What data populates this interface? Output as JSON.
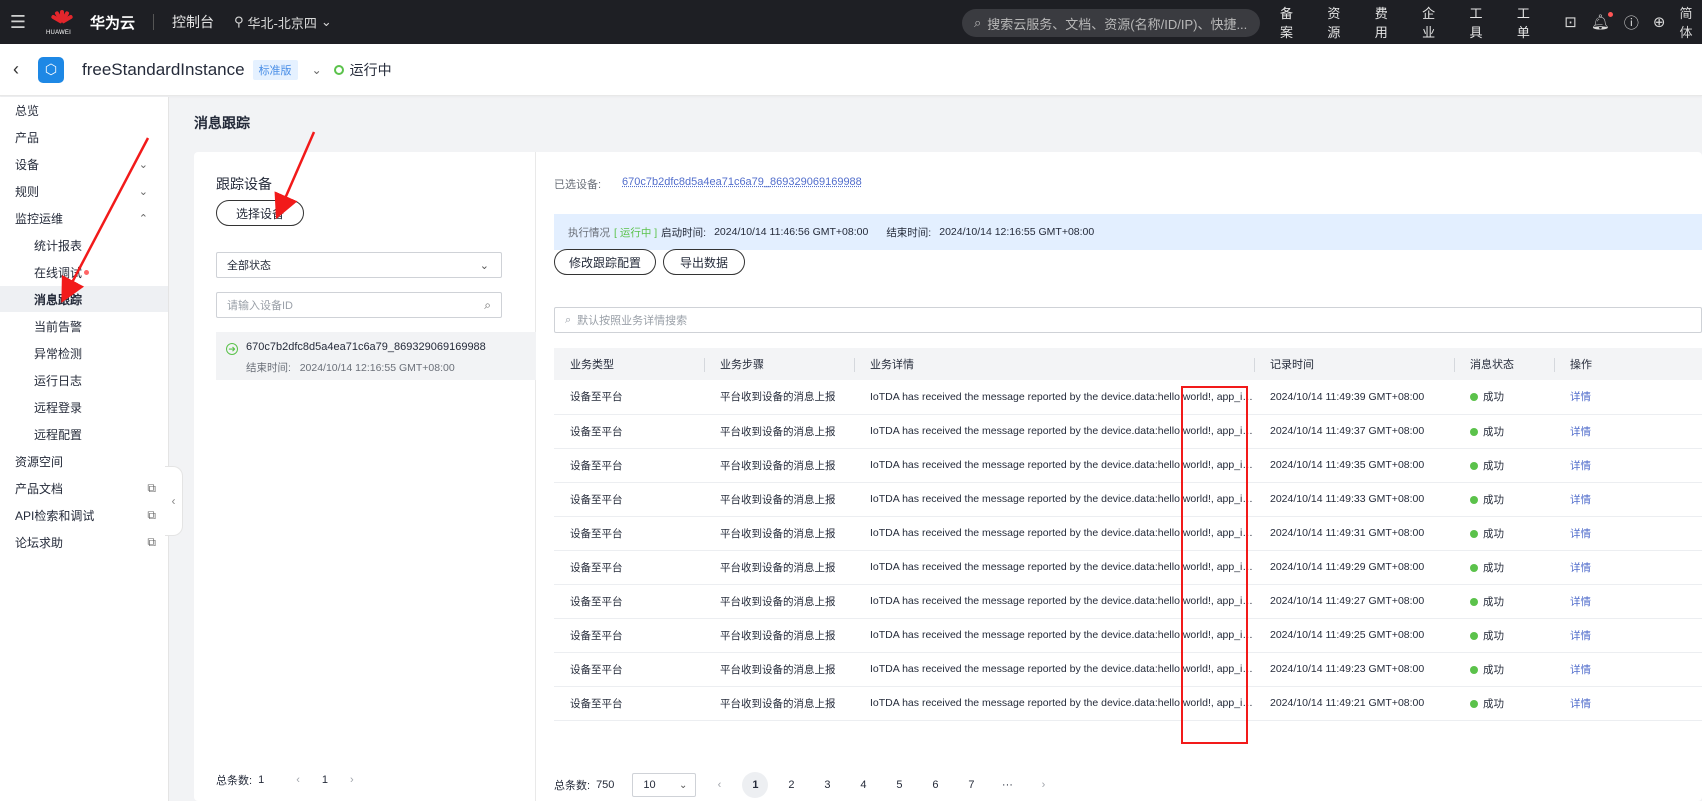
{
  "topbar": {
    "brand_logo_text": "HUAWEI",
    "brand_name": "华为云",
    "console": "控制台",
    "region": "华北-北京四",
    "search_placeholder": "搜索云服务、文档、资源(名称/ID/IP)、快捷...",
    "links": [
      "备案",
      "资源",
      "费用",
      "企业",
      "工具",
      "工单"
    ],
    "language": "简体"
  },
  "instance": {
    "name": "freeStandardInstance",
    "edition": "标准版",
    "status": "运行中"
  },
  "sidebar": {
    "items": [
      {
        "label": "总览"
      },
      {
        "label": "产品"
      },
      {
        "label": "设备"
      },
      {
        "label": "规则"
      },
      {
        "label": "监控运维"
      },
      {
        "label": "统计报表"
      },
      {
        "label": "在线调试"
      },
      {
        "label": "消息跟踪"
      },
      {
        "label": "当前告警"
      },
      {
        "label": "异常检测"
      },
      {
        "label": "运行日志"
      },
      {
        "label": "远程登录"
      },
      {
        "label": "远程配置"
      },
      {
        "label": "资源空间"
      },
      {
        "label": "产品文档"
      },
      {
        "label": "API检索和调试"
      },
      {
        "label": "论坛求助"
      }
    ]
  },
  "page": {
    "title": "消息跟踪"
  },
  "left_pane": {
    "title": "跟踪设备",
    "select_device_button": "选择设备",
    "status_filter": "全部状态",
    "device_id_placeholder": "请输入设备ID",
    "device": {
      "id": "670c7b2dfc8d5a4ea71c6a79_869329069169988",
      "end_time_label": "结束时间:",
      "end_time": "2024/10/14 12:16:55 GMT+08:00"
    },
    "total_label": "总条数:",
    "total": "1",
    "page": "1"
  },
  "right_pane": {
    "selected_label": "已选设备:",
    "selected_device": "670c7b2dfc8d5a4ea71c6a79_869329069169988",
    "exec_label": "执行情况",
    "exec_status": "[ 运行中 ]",
    "start_label": "启动时间:",
    "start_time": "2024/10/14 11:46:56 GMT+08:00",
    "end_label": "结束时间:",
    "end_time": "2024/10/14 12:16:55 GMT+08:00",
    "modify_button": "修改跟踪配置",
    "export_button": "导出数据",
    "search_placeholder": "默认按照业务详情搜索",
    "columns": [
      "业务类型",
      "业务步骤",
      "业务详情",
      "记录时间",
      "消息状态",
      "操作"
    ],
    "rows": [
      {
        "type": "设备至平台",
        "step": "平台收到设备的消息上报",
        "detail": "IoTDA has received the message reported by the device.data:hello world!, app_id: ...",
        "time": "2024/10/14 11:49:39 GMT+08:00",
        "status": "成功",
        "action": "详情"
      },
      {
        "type": "设备至平台",
        "step": "平台收到设备的消息上报",
        "detail": "IoTDA has received the message reported by the device.data:hello world!, app_id: ...",
        "time": "2024/10/14 11:49:37 GMT+08:00",
        "status": "成功",
        "action": "详情"
      },
      {
        "type": "设备至平台",
        "step": "平台收到设备的消息上报",
        "detail": "IoTDA has received the message reported by the device.data:hello world!, app_id: ...",
        "time": "2024/10/14 11:49:35 GMT+08:00",
        "status": "成功",
        "action": "详情"
      },
      {
        "type": "设备至平台",
        "step": "平台收到设备的消息上报",
        "detail": "IoTDA has received the message reported by the device.data:hello world!, app_id: ...",
        "time": "2024/10/14 11:49:33 GMT+08:00",
        "status": "成功",
        "action": "详情"
      },
      {
        "type": "设备至平台",
        "step": "平台收到设备的消息上报",
        "detail": "IoTDA has received the message reported by the device.data:hello world!, app_id: ...",
        "time": "2024/10/14 11:49:31 GMT+08:00",
        "status": "成功",
        "action": "详情"
      },
      {
        "type": "设备至平台",
        "step": "平台收到设备的消息上报",
        "detail": "IoTDA has received the message reported by the device.data:hello world!, app_id: ...",
        "time": "2024/10/14 11:49:29 GMT+08:00",
        "status": "成功",
        "action": "详情"
      },
      {
        "type": "设备至平台",
        "step": "平台收到设备的消息上报",
        "detail": "IoTDA has received the message reported by the device.data:hello world!, app_id: ...",
        "time": "2024/10/14 11:49:27 GMT+08:00",
        "status": "成功",
        "action": "详情"
      },
      {
        "type": "设备至平台",
        "step": "平台收到设备的消息上报",
        "detail": "IoTDA has received the message reported by the device.data:hello world!, app_id: ...",
        "time": "2024/10/14 11:49:25 GMT+08:00",
        "status": "成功",
        "action": "详情"
      },
      {
        "type": "设备至平台",
        "step": "平台收到设备的消息上报",
        "detail": "IoTDA has received the message reported by the device.data:hello world!, app_id: ...",
        "time": "2024/10/14 11:49:23 GMT+08:00",
        "status": "成功",
        "action": "详情"
      },
      {
        "type": "设备至平台",
        "step": "平台收到设备的消息上报",
        "detail": "IoTDA has received the message reported by the device.data:hello world!, app_id: ...",
        "time": "2024/10/14 11:49:21 GMT+08:00",
        "status": "成功",
        "action": "详情"
      }
    ],
    "total_label": "总条数:",
    "total": "750",
    "page_size": "10",
    "pages": [
      "1",
      "2",
      "3",
      "4",
      "5",
      "6",
      "7",
      "···"
    ],
    "current_page": "1"
  },
  "colors": {
    "topbar_bg": "#1e1f24",
    "success": "#5bc24b",
    "link": "#526ecc",
    "annotation_red": "#f21a1a"
  }
}
